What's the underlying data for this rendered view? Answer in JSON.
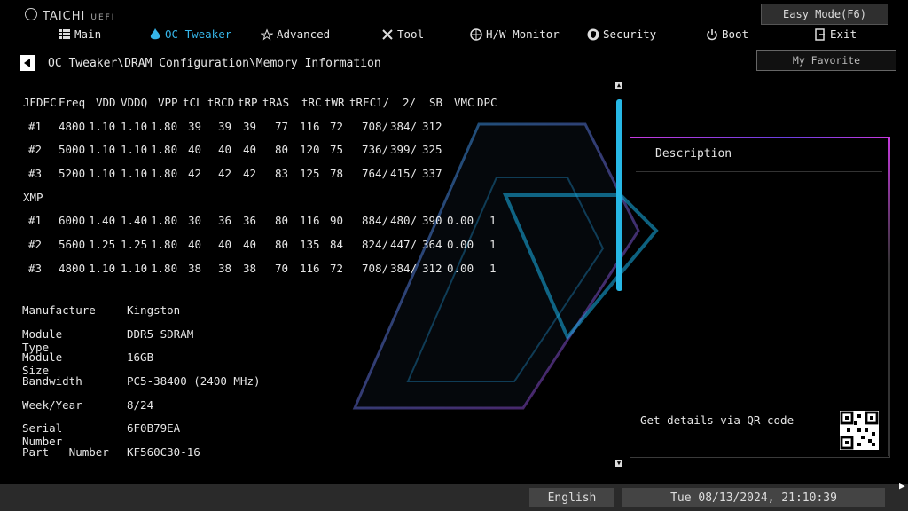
{
  "brand": {
    "name": "TAICHI",
    "sub": "UEFI"
  },
  "easy_mode_label": "Easy Mode(F6)",
  "my_favorite_label": "My Favorite",
  "nav": [
    {
      "label": "Main",
      "icon": "list-icon",
      "active": false
    },
    {
      "label": "OC Tweaker",
      "icon": "flame-icon",
      "active": true
    },
    {
      "label": "Advanced",
      "icon": "star-icon",
      "active": false
    },
    {
      "label": "Tool",
      "icon": "tools-icon",
      "active": false
    },
    {
      "label": "H/W Monitor",
      "icon": "monitor-icon",
      "active": false
    },
    {
      "label": "Security",
      "icon": "shield-icon",
      "active": false
    },
    {
      "label": "Boot",
      "icon": "power-icon",
      "active": false
    },
    {
      "label": "Exit",
      "icon": "exit-icon",
      "active": false
    }
  ],
  "breadcrumb": "OC Tweaker\\DRAM Configuration\\Memory Information",
  "table": {
    "headers": [
      "JEDEC",
      "Freq",
      "VDD",
      "VDDQ",
      "VPP",
      "tCL",
      "tRCD",
      "tRP",
      "tRAS",
      "tRC",
      "tWR",
      "tRFC1/",
      "2/",
      "SB",
      "VMC",
      "DPC"
    ],
    "jedec": [
      [
        "#1",
        "4800",
        "1.10",
        "1.10",
        "1.80",
        "39",
        "39",
        "39",
        "77",
        "116",
        "72",
        "708/",
        "384/",
        "312",
        "",
        ""
      ],
      [
        "#2",
        "5000",
        "1.10",
        "1.10",
        "1.80",
        "40",
        "40",
        "40",
        "80",
        "120",
        "75",
        "736/",
        "399/",
        "325",
        "",
        ""
      ],
      [
        "#3",
        "5200",
        "1.10",
        "1.10",
        "1.80",
        "42",
        "42",
        "42",
        "83",
        "125",
        "78",
        "764/",
        "415/",
        "337",
        "",
        ""
      ]
    ],
    "xmp_label": "XMP",
    "xmp": [
      [
        "#1",
        "6000",
        "1.40",
        "1.40",
        "1.80",
        "30",
        "36",
        "36",
        "80",
        "116",
        "90",
        "884/",
        "480/",
        "390",
        "0.00",
        "1"
      ],
      [
        "#2",
        "5600",
        "1.25",
        "1.25",
        "1.80",
        "40",
        "40",
        "40",
        "80",
        "135",
        "84",
        "824/",
        "447/",
        "364",
        "0.00",
        "1"
      ],
      [
        "#3",
        "4800",
        "1.10",
        "1.10",
        "1.80",
        "38",
        "38",
        "38",
        "70",
        "116",
        "72",
        "708/",
        "384/",
        "312",
        "0.00",
        "1"
      ]
    ]
  },
  "info": [
    {
      "label": "Manufacture",
      "value": "Kingston"
    },
    {
      "label": "Module Type",
      "value": "DDR5 SDRAM"
    },
    {
      "label": "Module Size",
      "value": "16GB"
    },
    {
      "label": "Bandwidth",
      "value": "PC5-38400 (2400 MHz)"
    },
    {
      "label": "Week/Year",
      "value": "8/24"
    },
    {
      "label": "Serial Number",
      "value": "6F0B79EA"
    },
    {
      "label": "Part   Number",
      "value": "KF560C30-16"
    }
  ],
  "description": {
    "title": "Description",
    "qr_text": "Get details via QR code"
  },
  "status": {
    "language": "English",
    "datetime": "Tue 08/13/2024, 21:10:39"
  },
  "colors": {
    "accent": "#27b8e6",
    "panel_border": "#c83be0"
  }
}
